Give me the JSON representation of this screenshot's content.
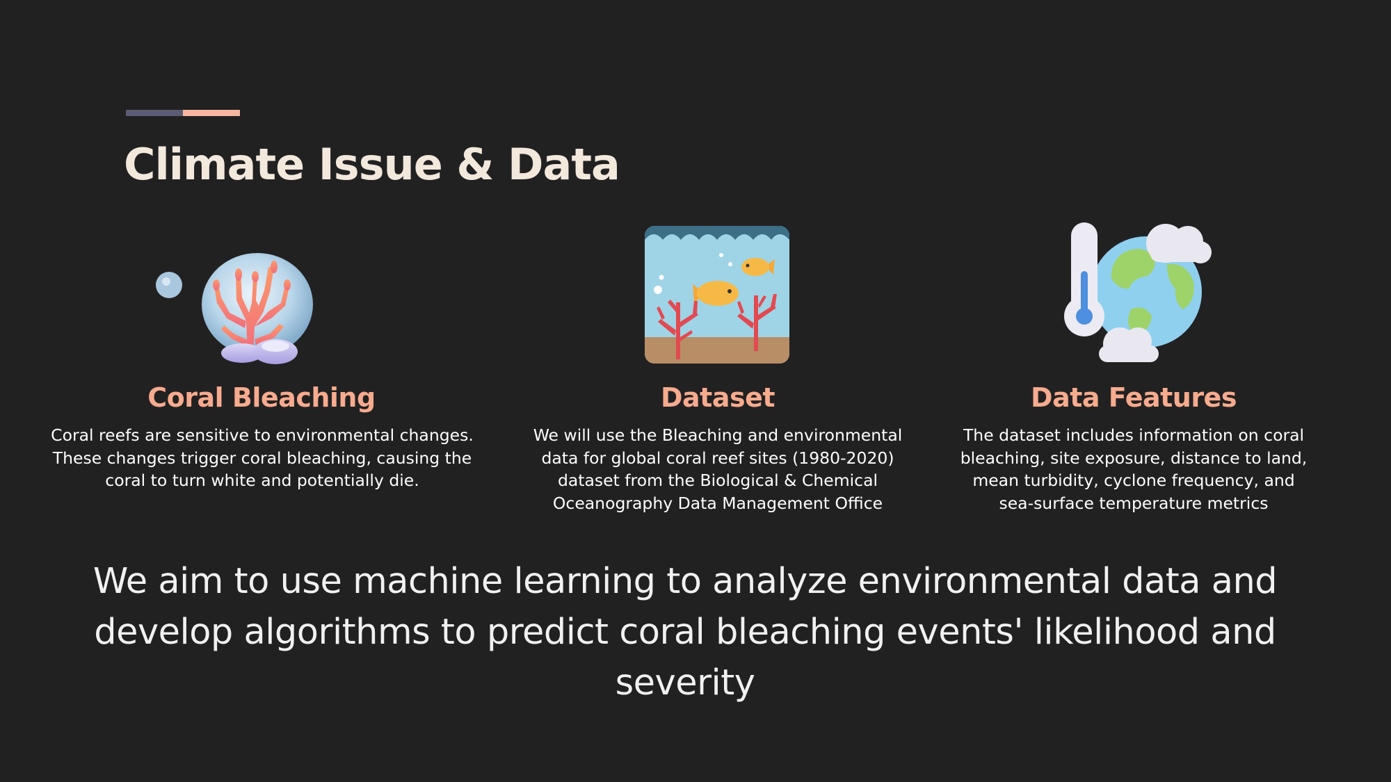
{
  "slide": {
    "title": "Climate Issue & Data",
    "accent_colors": [
      "#5b5b74",
      "#f7b6a0"
    ]
  },
  "columns": [
    {
      "icon": "coral-icon",
      "heading": "Coral Bleaching",
      "text": "Coral reefs are sensitive to environmental changes. These changes trigger coral bleaching, causing the coral to turn white and potentially die."
    },
    {
      "icon": "aquarium-fish-icon",
      "heading": "Dataset",
      "text": "We will use the Bleaching and environmental data for global coral reef sites (1980-2020) dataset from the Biological & Chemical Oceanography Data Management Office"
    },
    {
      "icon": "earth-thermometer-icon",
      "heading": "Data Features",
      "text": "The dataset includes information on coral bleaching, site exposure, distance to land, mean turbidity, cyclone frequency, and sea-surface temperature metrics"
    }
  ],
  "aim": "We aim to use machine learning to analyze environmental data and develop algorithms to predict coral bleaching events' likelihood and severity",
  "colors": {
    "background": "#222122",
    "title": "#f3e8dc",
    "heading": "#f7ab8e",
    "body": "#ffffff"
  }
}
